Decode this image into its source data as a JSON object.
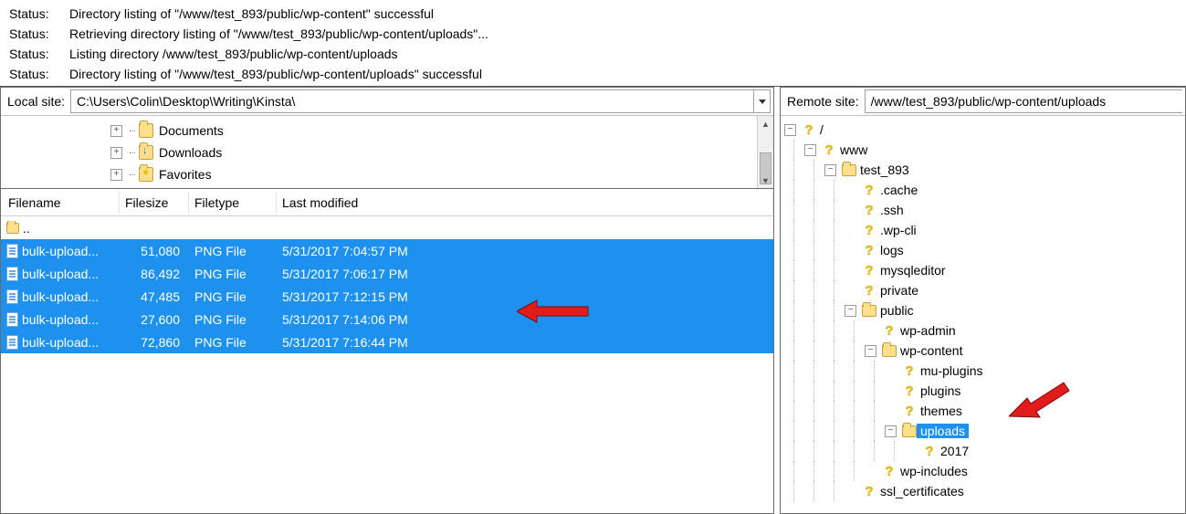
{
  "status": {
    "label": "Status:",
    "lines": [
      "Directory listing of \"/www/test_893/public/wp-content\" successful",
      "Retrieving directory listing of \"/www/test_893/public/wp-content/uploads\"...",
      "Listing directory /www/test_893/public/wp-content/uploads",
      "Directory listing of \"/www/test_893/public/wp-content/uploads\" successful"
    ]
  },
  "local": {
    "site_label": "Local site:",
    "path": "C:\\Users\\Colin\\Desktop\\Writing\\Kinsta\\",
    "tree": [
      {
        "name": "Documents",
        "icon": "folder"
      },
      {
        "name": "Downloads",
        "icon": "folder-dl"
      },
      {
        "name": "Favorites",
        "icon": "folder-fav"
      }
    ],
    "columns": {
      "name": "Filename",
      "size": "Filesize",
      "type": "Filetype",
      "modified": "Last modified"
    },
    "parent_row": "..",
    "files": [
      {
        "name": "bulk-upload...",
        "size": "51,080",
        "type": "PNG File",
        "modified": "5/31/2017 7:04:57 PM",
        "selected": true
      },
      {
        "name": "bulk-upload...",
        "size": "86,492",
        "type": "PNG File",
        "modified": "5/31/2017 7:06:17 PM",
        "selected": true
      },
      {
        "name": "bulk-upload...",
        "size": "47,485",
        "type": "PNG File",
        "modified": "5/31/2017 7:12:15 PM",
        "selected": true
      },
      {
        "name": "bulk-upload...",
        "size": "27,600",
        "type": "PNG File",
        "modified": "5/31/2017 7:14:06 PM",
        "selected": true
      },
      {
        "name": "bulk-upload...",
        "size": "72,860",
        "type": "PNG File",
        "modified": "5/31/2017 7:16:44 PM",
        "selected": true
      }
    ]
  },
  "remote": {
    "site_label": "Remote site:",
    "path": "/www/test_893/public/wp-content/uploads",
    "tree": [
      {
        "d": 0,
        "exp": "minus",
        "icon": "q",
        "name": "/"
      },
      {
        "d": 1,
        "exp": "minus",
        "icon": "q",
        "name": "www"
      },
      {
        "d": 2,
        "exp": "minus",
        "icon": "qfolder",
        "name": "test_893"
      },
      {
        "d": 3,
        "exp": "blank",
        "icon": "q",
        "name": ".cache"
      },
      {
        "d": 3,
        "exp": "blank",
        "icon": "q",
        "name": ".ssh"
      },
      {
        "d": 3,
        "exp": "blank",
        "icon": "q",
        "name": ".wp-cli"
      },
      {
        "d": 3,
        "exp": "blank",
        "icon": "q",
        "name": "logs"
      },
      {
        "d": 3,
        "exp": "blank",
        "icon": "q",
        "name": "mysqleditor"
      },
      {
        "d": 3,
        "exp": "blank",
        "icon": "q",
        "name": "private"
      },
      {
        "d": 3,
        "exp": "minus",
        "icon": "qfolder",
        "name": "public"
      },
      {
        "d": 4,
        "exp": "blank",
        "icon": "q",
        "name": "wp-admin"
      },
      {
        "d": 4,
        "exp": "minus",
        "icon": "qfolder",
        "name": "wp-content"
      },
      {
        "d": 5,
        "exp": "blank",
        "icon": "q",
        "name": "mu-plugins"
      },
      {
        "d": 5,
        "exp": "blank",
        "icon": "q",
        "name": "plugins"
      },
      {
        "d": 5,
        "exp": "blank",
        "icon": "q",
        "name": "themes"
      },
      {
        "d": 5,
        "exp": "minus",
        "icon": "qfolder",
        "name": "uploads",
        "selected": true
      },
      {
        "d": 6,
        "exp": "blank",
        "icon": "q",
        "name": "2017"
      },
      {
        "d": 4,
        "exp": "blank",
        "icon": "q",
        "name": "wp-includes"
      },
      {
        "d": 3,
        "exp": "blank",
        "icon": "q",
        "name": "ssl_certificates"
      }
    ]
  }
}
